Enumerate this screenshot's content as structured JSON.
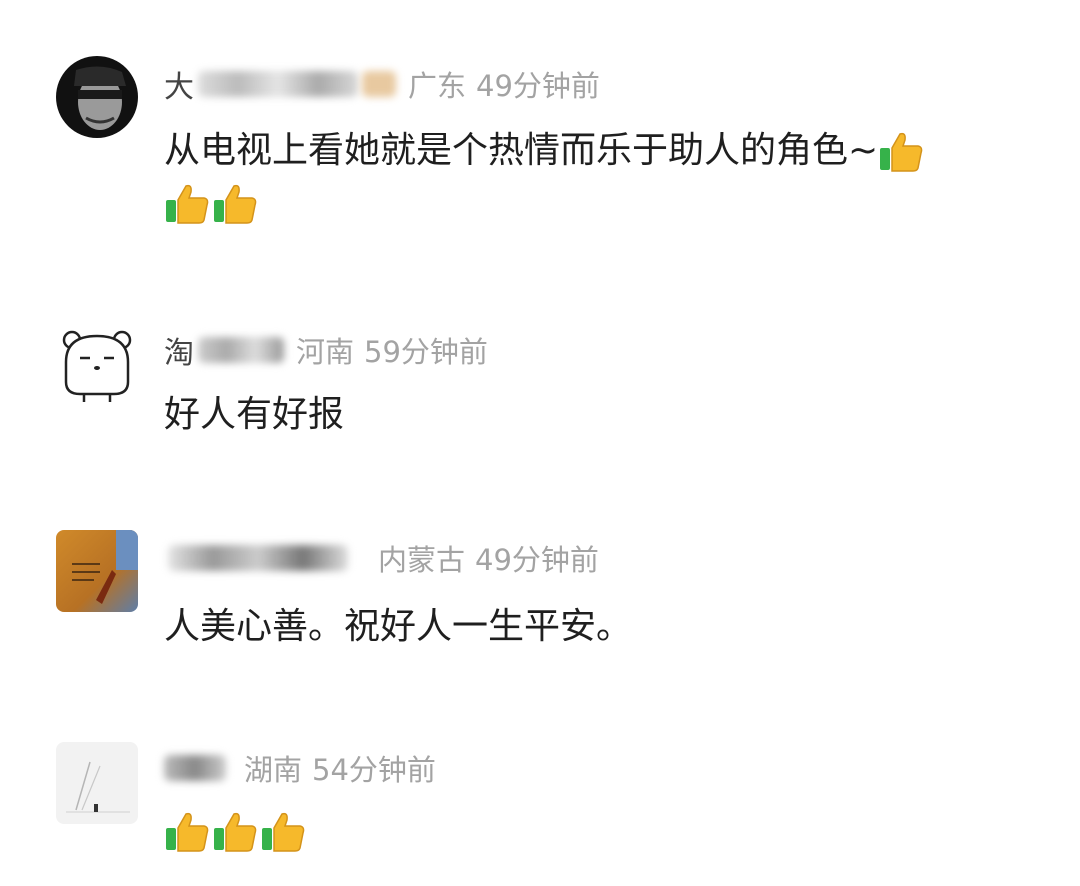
{
  "comments": [
    {
      "name_visible": "大",
      "location": "广东",
      "time": "49分钟前",
      "text": "从电视上看她就是个热情而乐于助人的角色~",
      "emoji": [
        "thumbs-up",
        "thumbs-up",
        "thumbs-up"
      ]
    },
    {
      "name_visible": "淘",
      "location": "河南",
      "time": "59分钟前",
      "text": "好人有好报",
      "emoji": []
    },
    {
      "name_visible": "",
      "location": "内蒙古",
      "time": "49分钟前",
      "text": "人美心善。祝好人一生平安。",
      "emoji": []
    },
    {
      "name_visible": "",
      "location": "湖南",
      "time": "54分钟前",
      "text": "",
      "emoji": [
        "thumbs-up",
        "thumbs-up",
        "thumbs-up"
      ]
    }
  ],
  "colors": {
    "meta_gray": "#a3a3a3",
    "text": "#1f1f1f",
    "thumb_yellow": "#f6b92b",
    "thumb_green": "#36b24a"
  }
}
